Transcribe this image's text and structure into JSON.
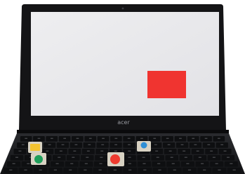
{
  "photo": {
    "brand_label": "acer",
    "screen": {
      "color": "#e8e8ea"
    },
    "screen_target": {
      "shape": "rectangle",
      "color": "#f03430"
    },
    "stickers": [
      {
        "name": "yellow-sticker",
        "shape": "square",
        "color": "#f2c230"
      },
      {
        "name": "green-sticker",
        "shape": "circle",
        "color": "#1f9e5a"
      },
      {
        "name": "red-sticker",
        "shape": "circle",
        "color": "#ee3b2f"
      },
      {
        "name": "blue-sticker",
        "shape": "circle",
        "color": "#2f8fd6"
      }
    ],
    "colors": {
      "bezel": "#141416",
      "deck": "#1b1c1f",
      "key": "#0e0f11",
      "key_legend": "#8a8c92",
      "sticker_backing": "#d8d2c3",
      "background": "#ffffff"
    }
  }
}
